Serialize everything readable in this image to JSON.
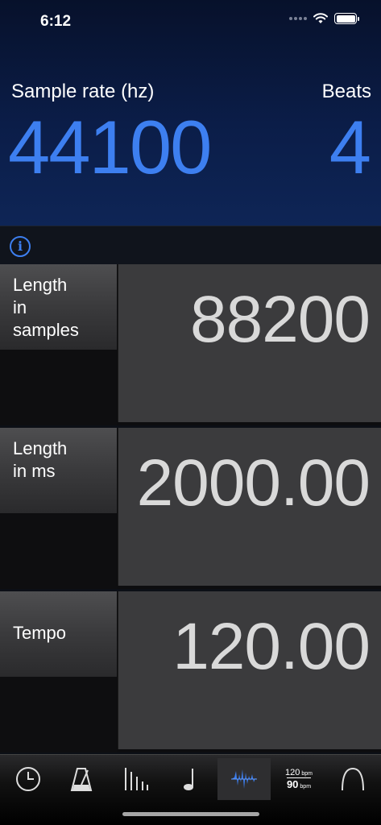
{
  "status_bar": {
    "time": "6:12"
  },
  "header": {
    "sample_rate_label": "Sample rate (hz)",
    "sample_rate_value": "44100",
    "beats_label": "Beats",
    "beats_value": "4"
  },
  "rows": [
    {
      "label": "Length\nin\nsamples",
      "value": "88200"
    },
    {
      "label": "Length\nin ms",
      "value": "2000.00"
    },
    {
      "label": "Tempo",
      "value": "120.00"
    }
  ],
  "tabbar": {
    "tabs": [
      {
        "icon": "clock-icon"
      },
      {
        "icon": "metronome-icon"
      },
      {
        "icon": "bars-icon"
      },
      {
        "icon": "note-icon"
      },
      {
        "icon": "waveform-icon",
        "selected": true
      },
      {
        "icon": "bpm-convert-icon",
        "top": "120",
        "bottom": "90",
        "unit": "bpm"
      },
      {
        "icon": "curve-icon"
      }
    ]
  },
  "colors": {
    "accent": "#3d7ff0",
    "header_bg": "#0b1d48",
    "value_text": "#d9d9d9"
  }
}
